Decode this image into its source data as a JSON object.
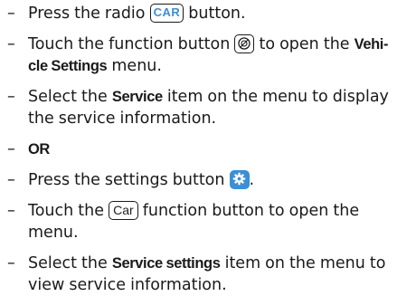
{
  "steps": [
    {
      "dash": "–",
      "p1": "Press the radio ",
      "btn": "CAR",
      "p2": " button."
    },
    {
      "dash": "–",
      "p1": "Touch the function button ",
      "p2": " to open the ",
      "b1": "Vehi-",
      "line2_b": "cle Settings",
      "line2_t": " menu."
    },
    {
      "dash": "–",
      "p1": "Select the ",
      "b1": "Service",
      "p2": " item on the menu to display",
      "line2": "the service information."
    },
    {
      "dash": "–",
      "b1": "OR"
    },
    {
      "dash": "–",
      "p1": "Press the settings button ",
      "p2": "."
    },
    {
      "dash": "–",
      "p1": "Touch the ",
      "btn": "Car",
      "p2": " function button to open the",
      "line2": "menu."
    },
    {
      "dash": "–",
      "p1": "Select the ",
      "b1": "Service settings",
      "p2": " item on the menu to",
      "line2": "view service information."
    }
  ],
  "icons": {
    "vehicle_function": "vehicle-settings-icon",
    "settings": "gear-icon"
  },
  "colors": {
    "text": "#1a1a1a",
    "accent": "#3b8fd6"
  }
}
